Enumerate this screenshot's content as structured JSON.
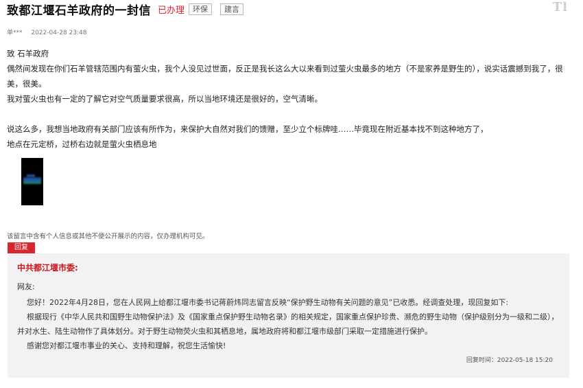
{
  "header": {
    "title": "致都江堰石羊政府的一封信",
    "status": "已办理",
    "tags": [
      "环保",
      "建言"
    ],
    "logo_text": "Tl"
  },
  "meta": {
    "author": "单***",
    "datetime": "2022-04-28 23:48"
  },
  "letter": {
    "salutation": "致 石羊政府",
    "para1": "偶然间发现在你们石羊管辖范围内有萤火虫，我个人没见过世面，反正是我长这么大以来看到过萤火虫最多的地方（不是家养是野生的），说实话震撼到我了，很美，很美。",
    "para2": "我对萤火虫也有一定的了解它对空气质量要求很高，所以当地环境还是很好的，空气清晰。",
    "para3": "说这么多，我想当地政府有关部门应该有所作为，来保护大自然对我们的馈赠，至少立个标牌哇……毕竟现在附近基本找不到这种地方了，",
    "para4": "地点在元定桥，过桥右边就是萤火虫栖息地"
  },
  "privacy_notice": "该留言中含有个人信息或其他不便公开展示的内容，仅办理机构可见。",
  "reply": {
    "tab_label": "回复",
    "org": "中共都江堰市委:",
    "greeting": "网友:",
    "p1": "您好！2022年4月28日，您在人民网上给都江堰市委书记蒋蔚炜同志留言反映“保护野生动物有关问题的意见”已收悉。经调查处理，现回复如下:",
    "p2": "根据现行《中华人民共和国野生动物保护法》及《国家重点保护野生动物名录》的相关规定，国家重点保护珍贵、濒危的野生动物（保护级别分为一级和二级），并对水生、陆生动物作了具体划分。对于野生动物荧火虫和其栖息地，属地政府将和都江堰市级部门采取一定措施进行保护。",
    "p3": "感谢您对都江堰市事业的关心、支持和理解，祝您生活愉快!",
    "time": "回复时间：2022-05-18 15:20"
  },
  "colors": {
    "accent_red": "#d8262c",
    "reply_bg": "#f2f2f4"
  }
}
